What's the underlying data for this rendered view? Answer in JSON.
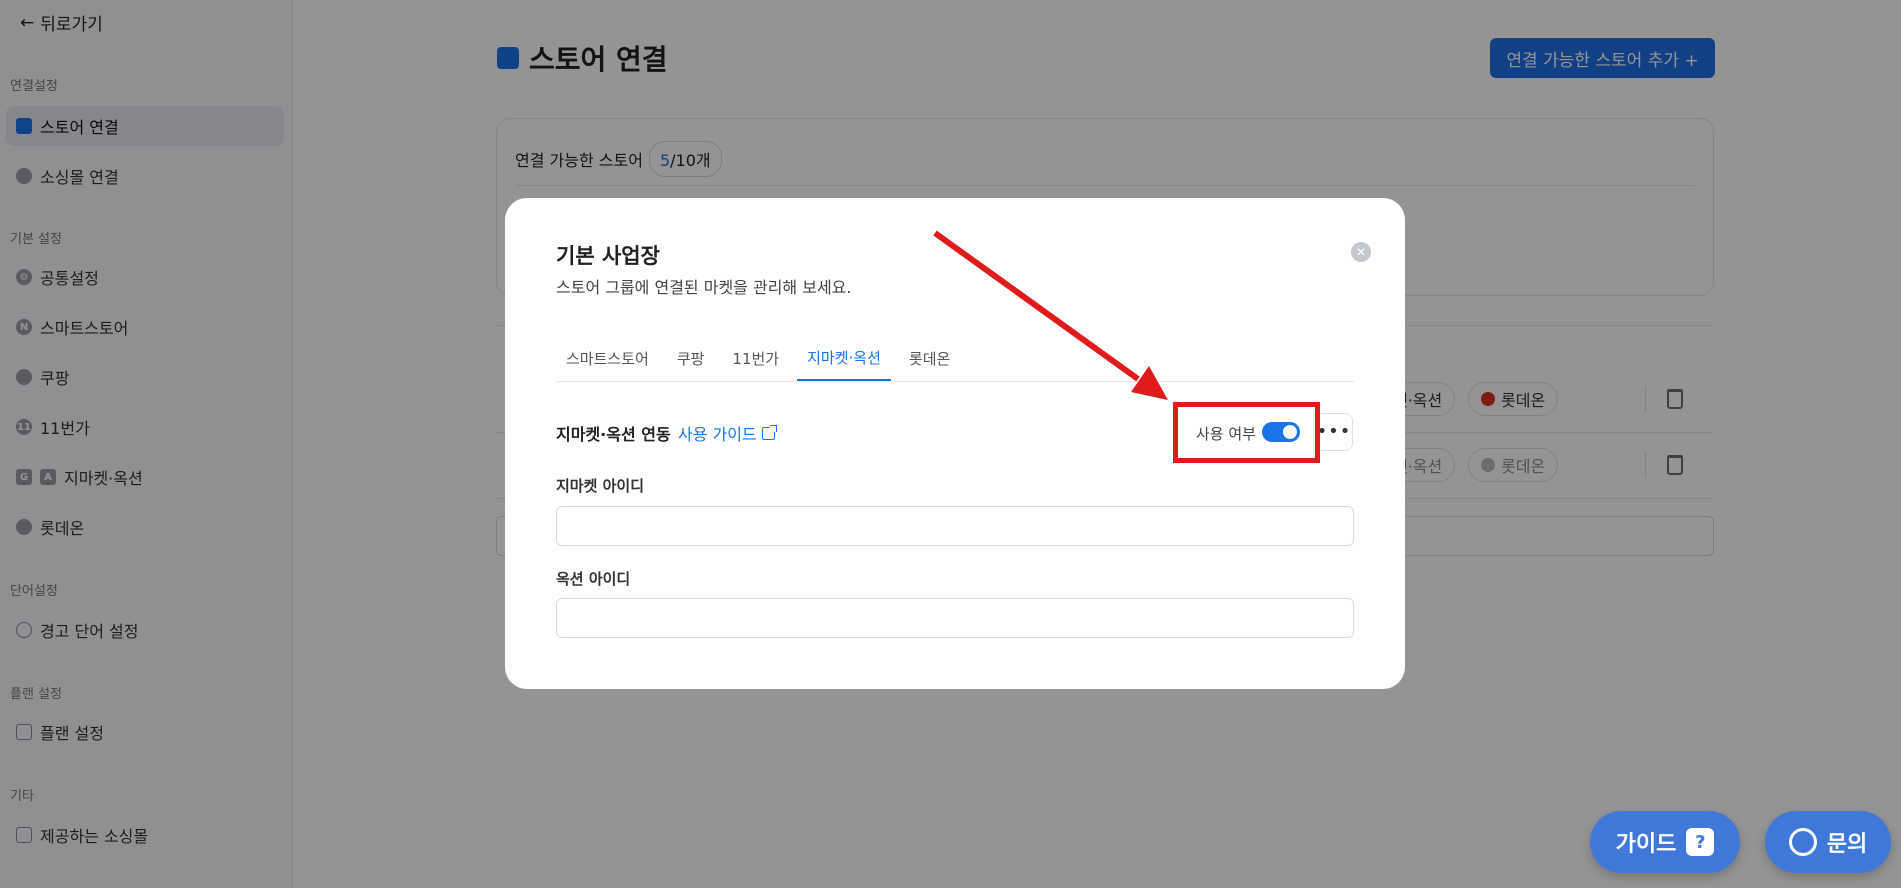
{
  "sidebar": {
    "back_label": "뒤로가기",
    "sections": {
      "connect": "연결설정",
      "basic": "기본 설정",
      "words": "단어설정",
      "plan": "플랜 설정",
      "etc": "기타"
    },
    "items": {
      "store_connect": "스토어 연결",
      "social_connect": "소싱몰 연결",
      "common_settings": "공통설정",
      "smartstore": "스마트스토어",
      "coupang": "쿠팡",
      "elevenst": "11번가",
      "gmarket_auction": "지마켓·옥션",
      "lotteon": "롯데온",
      "warning_words": "경고 단어 설정",
      "plan_settings": "플랜 설정",
      "provided_malls": "제공하는 소싱몰"
    }
  },
  "main": {
    "title": "스토어 연결",
    "add_button": "연결 가능한 스토어 추가 +",
    "connectable_label": "연결 가능한 스토어",
    "count_current": "5",
    "count_total": "/10개",
    "row_chips": {
      "gmarket": "켓·옥션",
      "lotteon": "롯데온"
    }
  },
  "modal": {
    "title": "기본 사업장",
    "subtitle": "스토어 그룹에 연결된 마켓을 관리해 보세요.",
    "close_icon": "✕",
    "tabs": [
      "스마트스토어",
      "쿠팡",
      "11번가",
      "지마켓·옥션",
      "롯데온"
    ],
    "active_tab": 3,
    "sync_label": "지마켓·옥션 연동",
    "guide_link": "사용 가이드",
    "use_label": "사용 여부",
    "use_enabled": true,
    "more_icon": "•••",
    "gmarket_id_label": "지마켓 아이디",
    "gmarket_id_value": "",
    "auction_id_label": "옥션 아이디",
    "auction_id_value": ""
  },
  "floating": {
    "guide_label": "가이드",
    "guide_icon": "?",
    "inquiry_label": "문의"
  },
  "colors": {
    "accent": "#1a73e8",
    "highlight": "#e01b1b",
    "floating": "#3f78d9"
  }
}
